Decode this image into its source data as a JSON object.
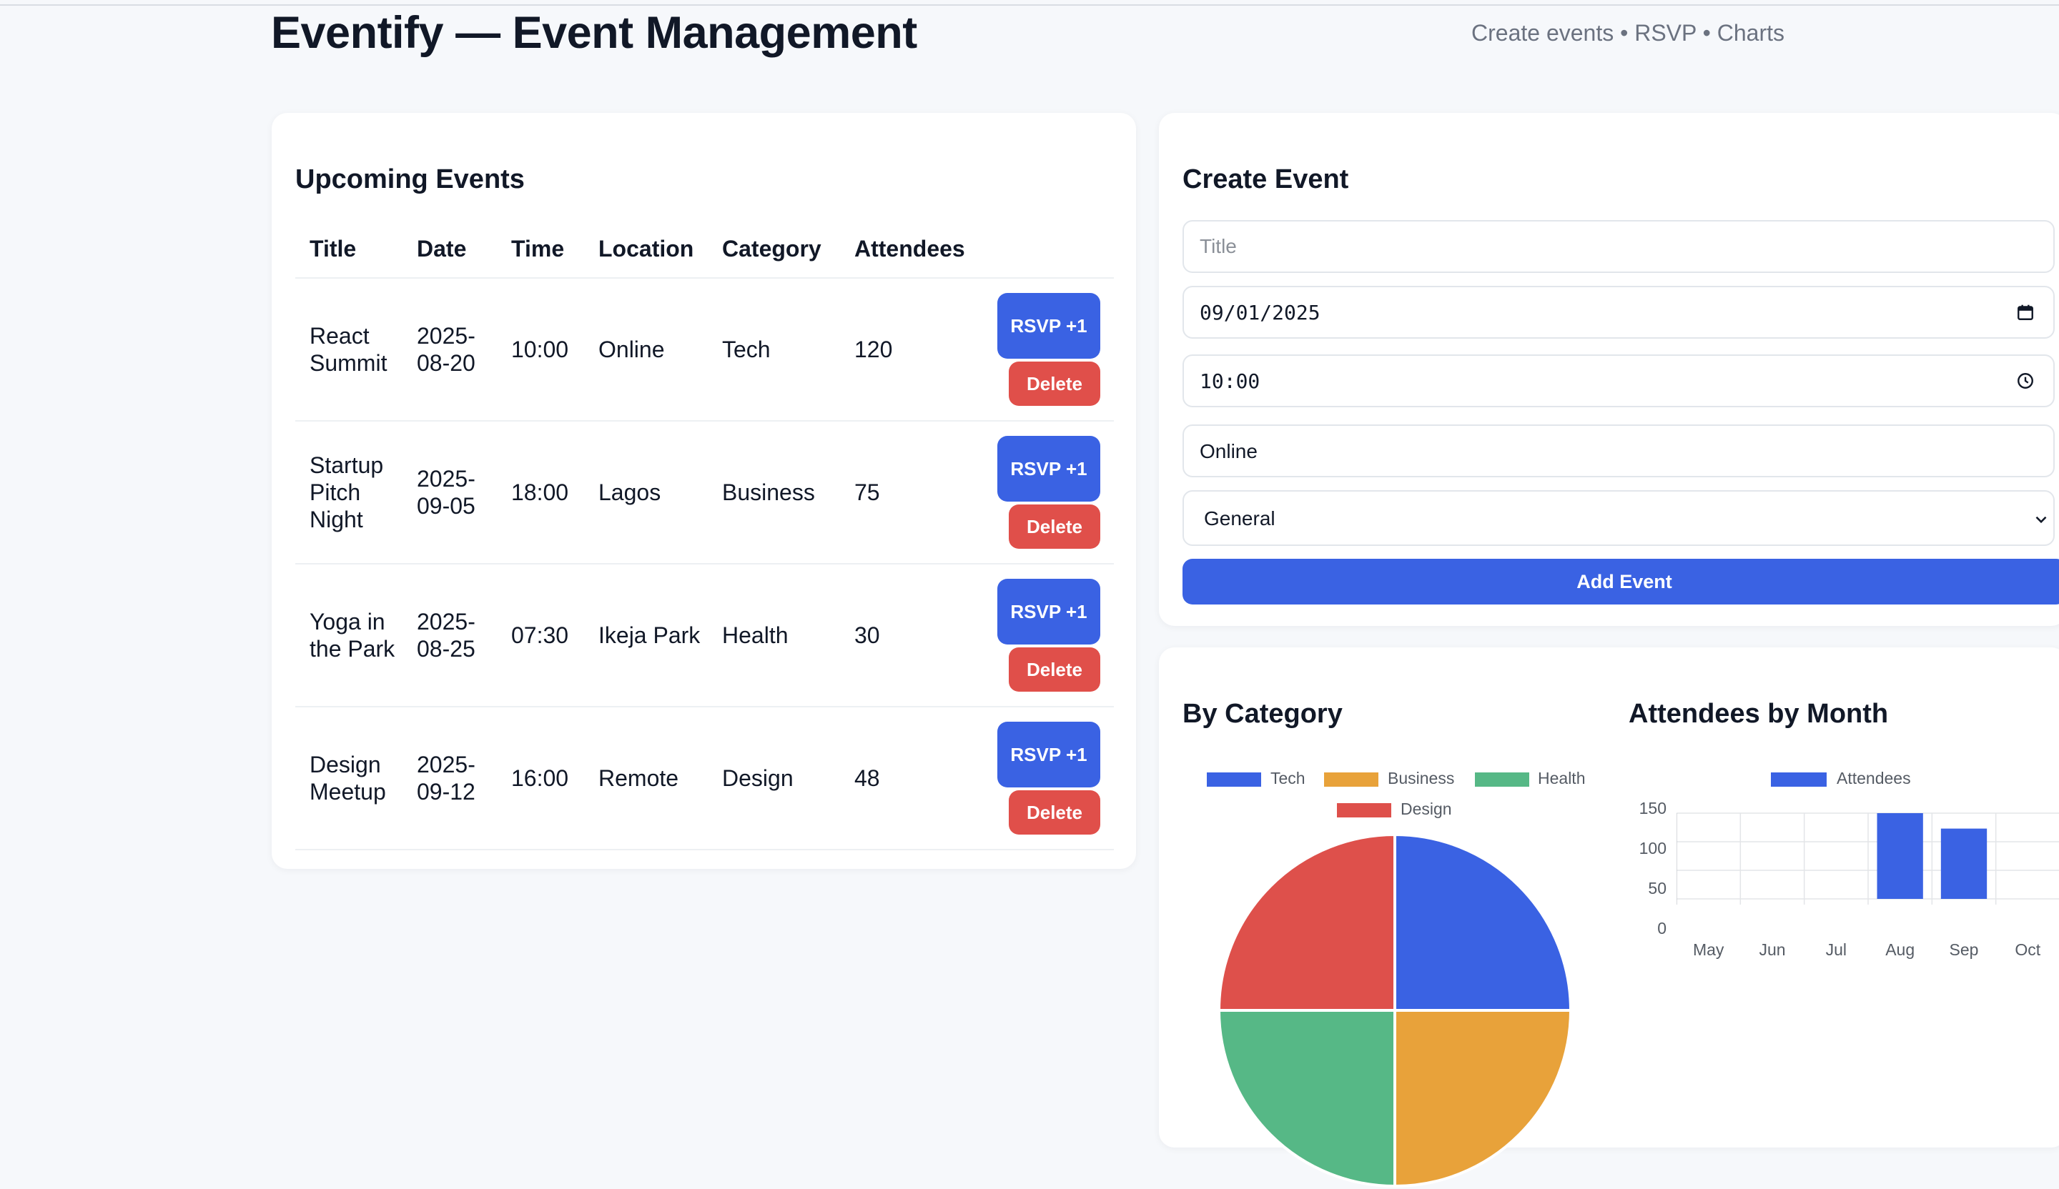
{
  "app": {
    "title": "Eventify — Event Management",
    "tagline": "Create events • RSVP • Charts"
  },
  "events": {
    "heading": "Upcoming Events",
    "columns": [
      "Title",
      "Date",
      "Time",
      "Location",
      "Category",
      "Attendees"
    ],
    "rows": [
      {
        "title": "React Summit",
        "date": "2025-08-20",
        "time": "10:00",
        "location": "Online",
        "category": "Tech",
        "attendees": "120",
        "rsvp_label": "RSVP +1",
        "delete_label": "Delete"
      },
      {
        "title": "Startup Pitch Night",
        "date": "2025-09-05",
        "time": "18:00",
        "location": "Lagos",
        "category": "Business",
        "attendees": "75",
        "rsvp_label": "RSVP +1",
        "delete_label": "Delete"
      },
      {
        "title": "Yoga in the Park",
        "date": "2025-08-25",
        "time": "07:30",
        "location": "Ikeja Park",
        "category": "Health",
        "attendees": "30",
        "rsvp_label": "RSVP +1",
        "delete_label": "Delete"
      },
      {
        "title": "Design Meetup",
        "date": "2025-09-12",
        "time": "16:00",
        "location": "Remote",
        "category": "Design",
        "attendees": "48",
        "rsvp_label": "RSVP +1",
        "delete_label": "Delete"
      }
    ]
  },
  "create": {
    "heading": "Create Event",
    "title_placeholder": "Title",
    "date_value": "09/01/2025",
    "time_value": "10:00",
    "location_value": "Online",
    "category_value": "General",
    "add_label": "Add Event",
    "icons": {
      "date": "calendar-icon",
      "time": "clock-icon",
      "select": "chevron-down-icon"
    }
  },
  "charts": {
    "category_heading": "By Category",
    "month_heading": "Attendees by Month"
  },
  "chart_data": [
    {
      "type": "pie",
      "title": "By Category",
      "labels": [
        "Tech",
        "Business",
        "Health",
        "Design"
      ],
      "values": [
        1,
        1,
        1,
        1
      ],
      "colors": [
        "#3a62e3",
        "#e8a23a",
        "#56b886",
        "#de504b"
      ],
      "legend": "top"
    },
    {
      "type": "bar",
      "title": "Attendees by Month",
      "categories": [
        "May",
        "Jun",
        "Jul",
        "Aug",
        "Sep",
        "Oct"
      ],
      "series": [
        {
          "name": "Attendees",
          "values": [
            0,
            0,
            0,
            150,
            123,
            0
          ],
          "color": "#3a62e3"
        }
      ],
      "yticks": [
        "150",
        "100",
        "50",
        "0"
      ],
      "ylim": [
        0,
        150
      ],
      "grid": true,
      "legend": "top"
    }
  ]
}
